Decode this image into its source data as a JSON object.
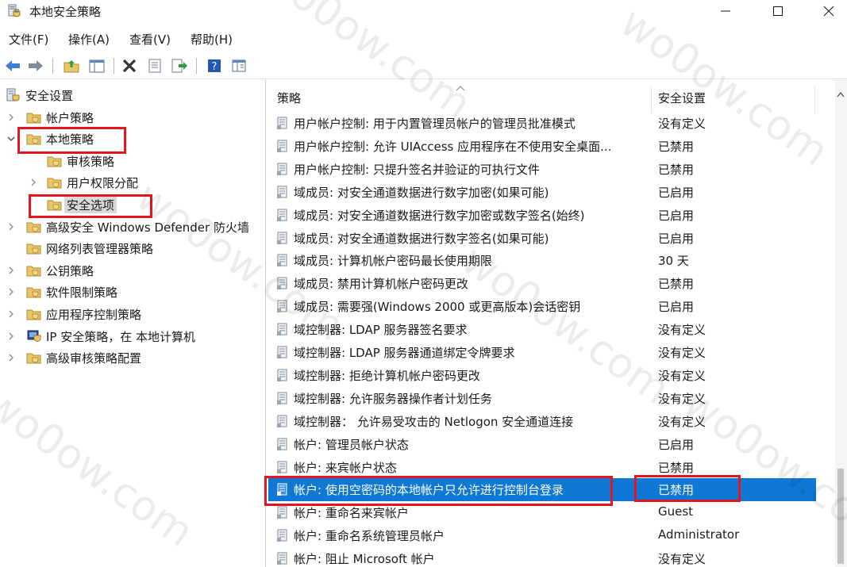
{
  "window": {
    "title": "本地安全策略"
  },
  "menu": [
    "文件(F)",
    "操作(A)",
    "查看(V)",
    "帮助(H)"
  ],
  "toolbar": [
    "back-arrow-icon",
    "forward-arrow-icon",
    "up-folder-icon",
    "show-hide-tree-icon",
    "delete-x-icon",
    "properties-icon",
    "export-icon",
    "help-icon",
    "console-icon"
  ],
  "tree": [
    {
      "label": "安全设置",
      "level": 0,
      "expander": "none",
      "icon": "security-settings-icon"
    },
    {
      "label": "帐户策略",
      "level": 1,
      "expander": "collapsed",
      "icon": "folder-icon"
    },
    {
      "label": "本地策略",
      "level": 1,
      "expander": "expanded",
      "icon": "folder-icon",
      "highlight": true
    },
    {
      "label": "审核策略",
      "level": 2,
      "expander": "none",
      "icon": "folder-icon"
    },
    {
      "label": "用户权限分配",
      "level": 2,
      "expander": "collapsed",
      "icon": "folder-icon"
    },
    {
      "label": "安全选项",
      "level": 2,
      "expander": "none",
      "icon": "folder-icon",
      "selected": true,
      "highlight": true
    },
    {
      "label": "高级安全 Windows Defender 防火墙",
      "level": 1,
      "expander": "collapsed",
      "icon": "folder-icon"
    },
    {
      "label": "网络列表管理器策略",
      "level": 1,
      "expander": "none",
      "icon": "folder-icon"
    },
    {
      "label": "公钥策略",
      "level": 1,
      "expander": "collapsed",
      "icon": "folder-icon"
    },
    {
      "label": "软件限制策略",
      "level": 1,
      "expander": "collapsed",
      "icon": "folder-icon"
    },
    {
      "label": "应用程序控制策略",
      "level": 1,
      "expander": "collapsed",
      "icon": "folder-icon"
    },
    {
      "label": "IP 安全策略，在 本地计算机",
      "level": 1,
      "expander": "collapsed",
      "icon": "ip-security-icon"
    },
    {
      "label": "高级审核策略配置",
      "level": 1,
      "expander": "collapsed",
      "icon": "folder-icon"
    }
  ],
  "columns": {
    "policy": "策略",
    "setting": "安全设置"
  },
  "rows": [
    {
      "policy": "用户帐户控制: 用于内置管理员帐户的管理员批准模式",
      "setting": "没有定义"
    },
    {
      "policy": "用户帐户控制: 允许 UIAccess 应用程序在不使用安全桌面...",
      "setting": "已禁用"
    },
    {
      "policy": "用户帐户控制: 只提升签名并验证的可执行文件",
      "setting": "已禁用"
    },
    {
      "policy": "域成员: 对安全通道数据进行数字加密(如果可能)",
      "setting": "已启用"
    },
    {
      "policy": "域成员: 对安全通道数据进行数字加密或数字签名(始终)",
      "setting": "已启用"
    },
    {
      "policy": "域成员: 对安全通道数据进行数字签名(如果可能)",
      "setting": "已启用"
    },
    {
      "policy": "域成员: 计算机帐户密码最长使用期限",
      "setting": "30 天"
    },
    {
      "policy": "域成员: 禁用计算机帐户密码更改",
      "setting": "已禁用"
    },
    {
      "policy": "域成员: 需要强(Windows 2000 或更高版本)会话密钥",
      "setting": "已启用"
    },
    {
      "policy": "域控制器: LDAP 服务器签名要求",
      "setting": "没有定义"
    },
    {
      "policy": "域控制器: LDAP 服务器通道绑定令牌要求",
      "setting": "没有定义"
    },
    {
      "policy": "域控制器: 拒绝计算机帐户密码更改",
      "setting": "没有定义"
    },
    {
      "policy": "域控制器: 允许服务器操作者计划任务",
      "setting": "没有定义"
    },
    {
      "policy": "域控制器： 允许易受攻击的 Netlogon 安全通道连接",
      "setting": "没有定义"
    },
    {
      "policy": "帐户: 管理员帐户状态",
      "setting": "已启用"
    },
    {
      "policy": "帐户: 来宾帐户状态",
      "setting": "已禁用"
    },
    {
      "policy": "帐户: 使用空密码的本地帐户只允许进行控制台登录",
      "setting": "已禁用",
      "selected": true,
      "highlight": true
    },
    {
      "policy": "帐户: 重命名来宾帐户",
      "setting": "Guest"
    },
    {
      "policy": "帐户: 重命名系统管理员帐户",
      "setting": "Administrator"
    },
    {
      "policy": "帐户: 阻止 Microsoft 帐户",
      "setting": "没有定义"
    }
  ],
  "watermark": "wo0ow.com",
  "colors": {
    "selection": "#0e78d4",
    "highlight_box": "#e2161e",
    "folder": "#e9c66b"
  }
}
